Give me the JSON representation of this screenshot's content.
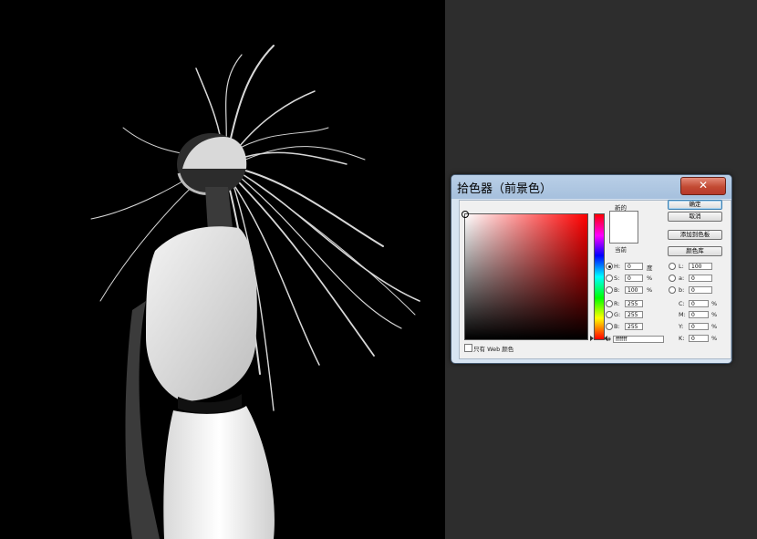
{
  "dialog": {
    "title": "拾色器（前景色）",
    "close_glyph": "✕",
    "new_label": "新的",
    "current_label": "当前",
    "buttons": {
      "ok": "确定",
      "cancel": "取消",
      "add_to_swatches": "添加到色板",
      "color_libraries": "颜色库"
    },
    "web_only_label": "只有 Web 颜色",
    "hex_label": "#",
    "hex_value": "ffffff",
    "fields": {
      "H": {
        "label": "H:",
        "value": "0",
        "unit": "度",
        "selected": true
      },
      "S": {
        "label": "S:",
        "value": "0",
        "unit": "%"
      },
      "B": {
        "label": "B:",
        "value": "100",
        "unit": "%"
      },
      "R": {
        "label": "R:",
        "value": "255"
      },
      "G": {
        "label": "G:",
        "value": "255"
      },
      "Bl": {
        "label": "B:",
        "value": "255"
      },
      "L": {
        "label": "L:",
        "value": "100"
      },
      "a": {
        "label": "a:",
        "value": "0"
      },
      "b": {
        "label": "b:",
        "value": "0"
      },
      "C": {
        "label": "C:",
        "value": "0",
        "unit": "%"
      },
      "M": {
        "label": "M:",
        "value": "0",
        "unit": "%"
      },
      "Y": {
        "label": "Y:",
        "value": "0",
        "unit": "%"
      },
      "K": {
        "label": "K:",
        "value": "0",
        "unit": "%"
      }
    },
    "new_color": "#ffffff",
    "current_color": "#ffffff"
  },
  "colors": {
    "canvas_bg": "#000000",
    "workspace_bg": "#2d2d2d",
    "close_button": "#c24a33"
  }
}
